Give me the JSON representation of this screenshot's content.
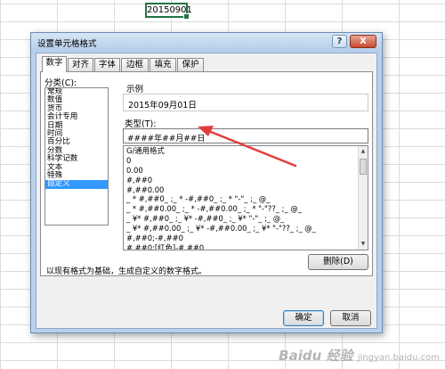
{
  "sheet": {
    "cell_value": "20150901"
  },
  "dialog": {
    "title": "设置单元格格式",
    "help_label": "?",
    "close_label": "X",
    "tabs": [
      {
        "label": "数字",
        "active": true
      },
      {
        "label": "对齐",
        "active": false
      },
      {
        "label": "字体",
        "active": false
      },
      {
        "label": "边框",
        "active": false
      },
      {
        "label": "填充",
        "active": false
      },
      {
        "label": "保护",
        "active": false
      }
    ],
    "category_label": "分类(C):",
    "categories": [
      "常规",
      "数值",
      "货币",
      "会计专用",
      "日期",
      "时间",
      "百分比",
      "分数",
      "科学记数",
      "文本",
      "特殊",
      "自定义"
    ],
    "selected_category": "自定义",
    "sample_label": "示例",
    "sample_value": "2015年09月01日",
    "type_label": "类型(T):",
    "type_value": "####年##月##日",
    "formats": [
      "G/通用格式",
      "0",
      "0.00",
      "#,##0",
      "#,##0.00",
      "_ * #,##0_ ;_ * -#,##0_ ;_ * \"-\"_ ;_ @_",
      "_ * #,##0.00_ ;_ * -#,##0.00_ ;_ * \"-\"??_ ;_ @_",
      "_ ¥* #,##0_ ;_ ¥* -#,##0_ ;_ ¥* \"-\"_ ;_ @_",
      "_ ¥* #,##0.00_ ;_ ¥* -#,##0.00_ ;_ ¥* \"-\"??_ ;_ @_",
      "#,##0;-#,##0",
      "#,##0;[红色]-#,##0"
    ],
    "delete_label": "删除(D)",
    "description": "以现有格式为基础，生成自定义的数字格式。",
    "ok_label": "确定",
    "cancel_label": "取消"
  },
  "annotation": {
    "arrow_color": "#e23c3c"
  },
  "watermark": {
    "main": "Baidu 经验",
    "sub": "jingyan.baidu.com"
  },
  "colors": {
    "selection": "#3399ff",
    "cell_border": "#217346",
    "title_bar": "#b8d0eb"
  }
}
